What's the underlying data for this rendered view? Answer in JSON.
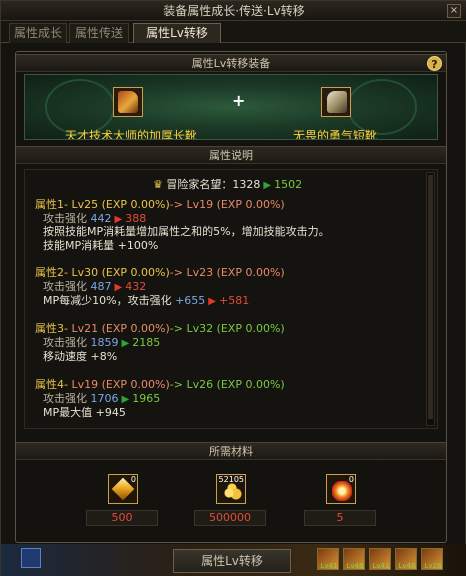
{
  "window": {
    "title": "装备属性成长·传送·Lv转移",
    "close_label": "×"
  },
  "tabs": [
    {
      "label": "属性成长",
      "active": false
    },
    {
      "label": "属性传送",
      "active": false
    },
    {
      "label": "属性Lv转移",
      "active": true
    }
  ],
  "equip_section": {
    "title": "属性Lv转移装备",
    "help_label": "?",
    "plus": "+",
    "source_item": {
      "name": "天才技术大师的加厚长靴",
      "icon": "orange-boots-icon"
    },
    "target_item": {
      "name": "无畏的勇气短靴",
      "icon": "white-boots-icon"
    }
  },
  "attr_section": {
    "title": "属性说明",
    "reputation": {
      "label": "冒险家名望：",
      "before": "1328",
      "after": "1502"
    },
    "attributes": [
      {
        "header_name": "属性1-",
        "header_from": "Lv25 (EXP 0.00%)",
        "header_arrow": "->",
        "header_to": "Lv19 (EXP 0.00%)",
        "stat_label": "攻击强化",
        "stat_from": "442",
        "stat_to": "388",
        "desc_1": "按照技能MP消耗量增加属性之和的5%，增加技能攻击力。",
        "desc_2": "技能MP消耗量 +100%"
      },
      {
        "header_name": "属性2-",
        "header_from": "Lv30 (EXP 0.00%)",
        "header_arrow": "->",
        "header_to": "Lv23 (EXP 0.00%)",
        "stat_label": "攻击强化",
        "stat_from": "487",
        "stat_to": "432",
        "desc_1_label": "MP每减少10%，攻击强化",
        "desc_1_from": "+655",
        "desc_1_to": "+581"
      },
      {
        "header_name": "属性3-",
        "header_from": "Lv21 (EXP 0.00%)",
        "header_arrow": "->",
        "header_to": "Lv32 (EXP 0.00%)",
        "stat_label": "攻击强化",
        "stat_from": "1859",
        "stat_to": "2185",
        "desc_1": "移动速度 +8%"
      },
      {
        "header_name": "属性4-",
        "header_from": "Lv19 (EXP 0.00%)",
        "header_arrow": "->",
        "header_to": "Lv26 (EXP 0.00%)",
        "stat_label": "攻击强化",
        "stat_from": "1706",
        "stat_to": "1965",
        "desc_1": "MP最大值 +945"
      }
    ]
  },
  "materials": {
    "title": "所需材料",
    "items": [
      {
        "icon": "gold-crystal-icon",
        "count": "0",
        "required": "500"
      },
      {
        "icon": "gold-coins-icon",
        "count": "52105",
        "required": "500000"
      },
      {
        "icon": "fire-orb-icon",
        "count": "0",
        "required": "5"
      }
    ]
  },
  "bottom": {
    "action_button": "属性Lv转移",
    "skill_levels": [
      "Lv41",
      "Lv46",
      "Lv41",
      "Lv46",
      "Lv28"
    ]
  }
}
